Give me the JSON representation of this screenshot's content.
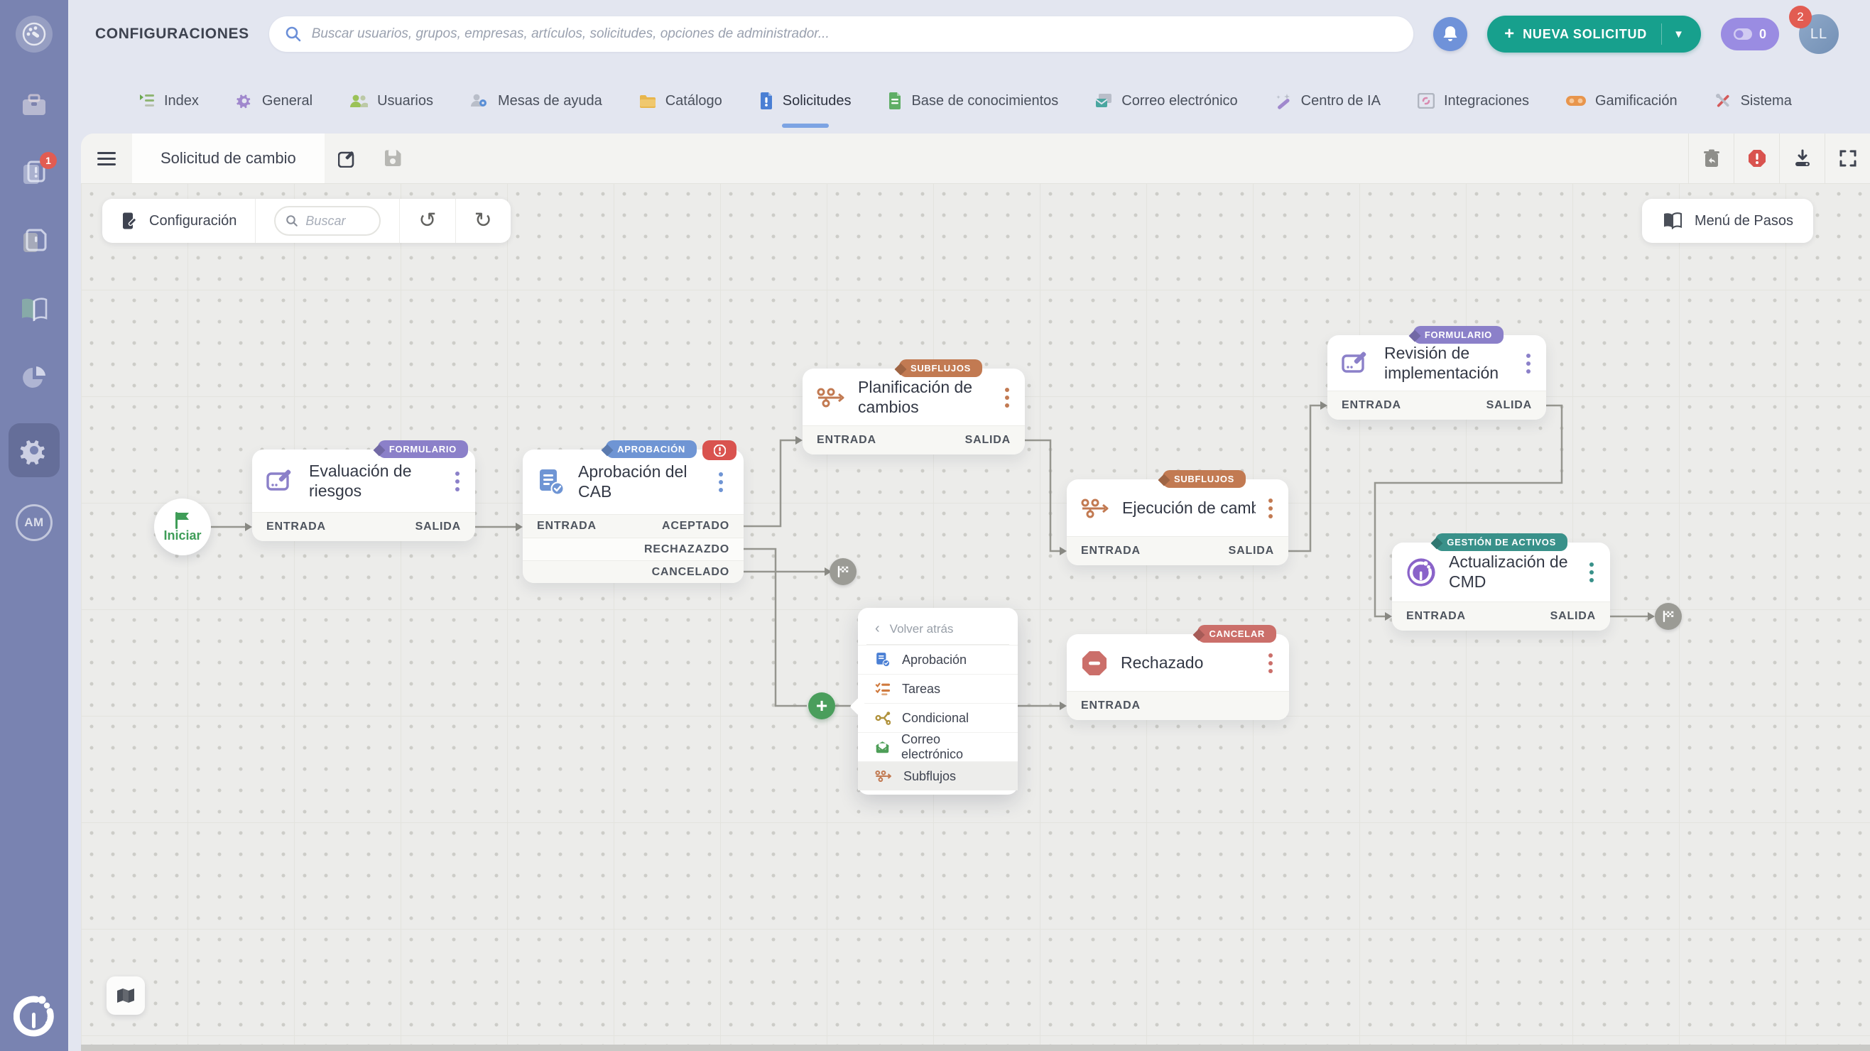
{
  "header": {
    "title": "CONFIGURACIONES",
    "search_placeholder": "Buscar usuarios, grupos, empresas, artículos, solicitudes, opciones de administrador...",
    "new_request_label": "NUEVA SOLICITUD",
    "credits_count": "0",
    "avatar_initials": "LL",
    "notifications_badge": "2"
  },
  "sidebar": {
    "notifications_badge": "1",
    "am_label": "AM"
  },
  "tabs": [
    {
      "label": "Index"
    },
    {
      "label": "General"
    },
    {
      "label": "Usuarios"
    },
    {
      "label": "Mesas de ayuda"
    },
    {
      "label": "Catálogo"
    },
    {
      "label": "Solicitudes",
      "active": true
    },
    {
      "label": "Base de conocimientos"
    },
    {
      "label": "Correo electrónico"
    },
    {
      "label": "Centro de IA"
    },
    {
      "label": "Integraciones"
    },
    {
      "label": "Gamificación"
    },
    {
      "label": "Sistema"
    }
  ],
  "toolbar": {
    "workflow_title": "Solicitud de cambio"
  },
  "canvas_toolbar": {
    "config_label": "Configuración",
    "search_placeholder": "Buscar",
    "steps_menu_label": "Menú de Pasos"
  },
  "workflow": {
    "start_label": "Iniciar",
    "nodes": {
      "evaluacion": {
        "badge": "FORMULARIO",
        "title": "Evaluación de riesgos",
        "entrada": "ENTRADA",
        "salida": "SALIDA"
      },
      "aprobacion": {
        "badge": "APROBACIÓN",
        "title": "Aprobación del CAB",
        "entrada": "ENTRADA",
        "outs": [
          "ACEPTADO",
          "RECHAZAZDO",
          "CANCELADO"
        ]
      },
      "planificacion": {
        "badge": "SUBFLUJOS",
        "title": "Planificación de cambios",
        "entrada": "ENTRADA",
        "salida": "SALIDA"
      },
      "ejecucion": {
        "badge": "SUBFLUJOS",
        "title": "Ejecución de camb",
        "entrada": "ENTRADA",
        "salida": "SALIDA"
      },
      "revision": {
        "badge": "FORMULARIO",
        "title": "Revisión de implementación",
        "entrada": "ENTRADA",
        "salida": "SALIDA"
      },
      "actualizacion": {
        "badge": "GESTIÓN DE ACTIVOS",
        "title": "Actualización de CMD",
        "entrada": "ENTRADA",
        "salida": "SALIDA"
      },
      "rechazado": {
        "badge": "CANCELAR",
        "title": "Rechazado",
        "entrada": "ENTRADA"
      }
    }
  },
  "context_menu": {
    "back_label": "Volver atrás",
    "items": [
      "Aprobación",
      "Tareas",
      "Condicional",
      "Correo electrónico",
      "Subflujos"
    ]
  },
  "colors": {
    "brand_teal": "#17a08d",
    "sidebar": "#7983b1",
    "badge_formulario": "#8b80c9",
    "badge_aprobacion": "#6f95d4",
    "badge_subflujos": "#c27a52",
    "badge_gestion_activos": "#39918a",
    "badge_cancelar": "#cb6f6a",
    "error_red": "#d9534f",
    "start_green": "#3f9d58",
    "plus_green": "#4a9e5c"
  }
}
